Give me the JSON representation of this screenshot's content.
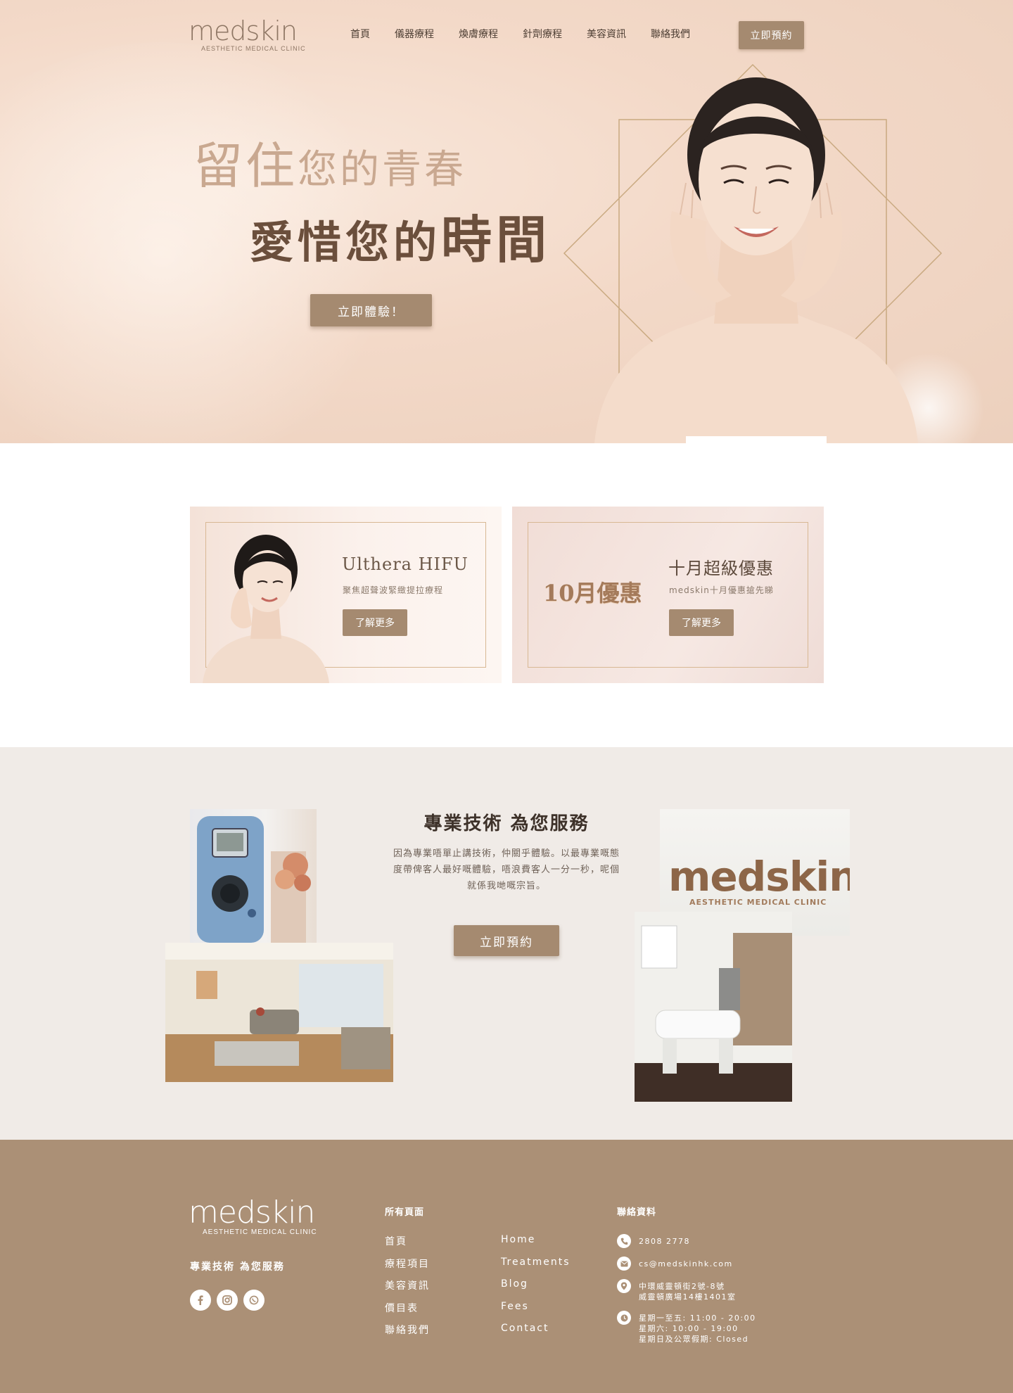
{
  "brand": {
    "logo_word": "medskin",
    "logo_sub": "AESTHETIC MEDICAL CLINIC"
  },
  "nav": {
    "items": [
      "首頁",
      "儀器療程",
      "煥膚療程",
      "針劑療程",
      "美容資訊",
      "聯絡我們"
    ],
    "cta": "立即預約"
  },
  "hero": {
    "line1_a": "留住",
    "line1_b": "您的青春",
    "line2_a": "愛惜您的",
    "line2_b": "時間",
    "button": "立即體驗！"
  },
  "promos": [
    {
      "title": "Ulthera HIFU",
      "subtitle": "聚焦超聲波緊緻提拉療程",
      "button": "了解更多"
    },
    {
      "badge": "10月優惠",
      "title": "十月超級優惠",
      "subtitle": "medskin十月優惠搶先睇",
      "button": "了解更多"
    }
  ],
  "service": {
    "title": "專業技術 為您服務",
    "text": "因為專業唔單止講技術，仲關乎體驗。以最專業嘅態度帶俾客人最好嘅體驗，唔浪費客人一分一秒，呢個就係我哋嘅宗旨。",
    "button": "立即預約",
    "sign_word": "medskin",
    "sign_sub": "AESTHETIC MEDICAL CLINIC"
  },
  "footer": {
    "logo_word": "medskin",
    "logo_sub": "AESTHETIC MEDICAL CLINIC",
    "tagline": "專業技術 為您服務",
    "pages_title": "所有頁面",
    "pages_zh": [
      "首頁",
      "療程項目",
      "美容資訊",
      "價目表",
      "聯絡我們"
    ],
    "pages_en": [
      "Home",
      "Treatments",
      "Blog",
      "Fees",
      "Contact"
    ],
    "contact_title": "聯絡資料",
    "phone": "2808 2778",
    "email": "cs@medskinhk.com",
    "address_1": "中環威靈頓街2號-8號",
    "address_2": "威靈頓廣場14樓1401室",
    "hours_1": "星期一至五: 11:00 - 20:00",
    "hours_2": "星期六: 10:00 - 19:00",
    "hours_3": "星期日及公眾假期: Closed"
  },
  "colors": {
    "accent": "#a58a70",
    "footer_bg": "#ab9076",
    "service_bg": "#f0ebe7",
    "hero_bg": "#f3d9c8"
  },
  "icons": [
    "facebook-icon",
    "instagram-icon",
    "whatsapp-icon",
    "phone-icon",
    "email-icon",
    "location-icon",
    "clock-icon"
  ]
}
